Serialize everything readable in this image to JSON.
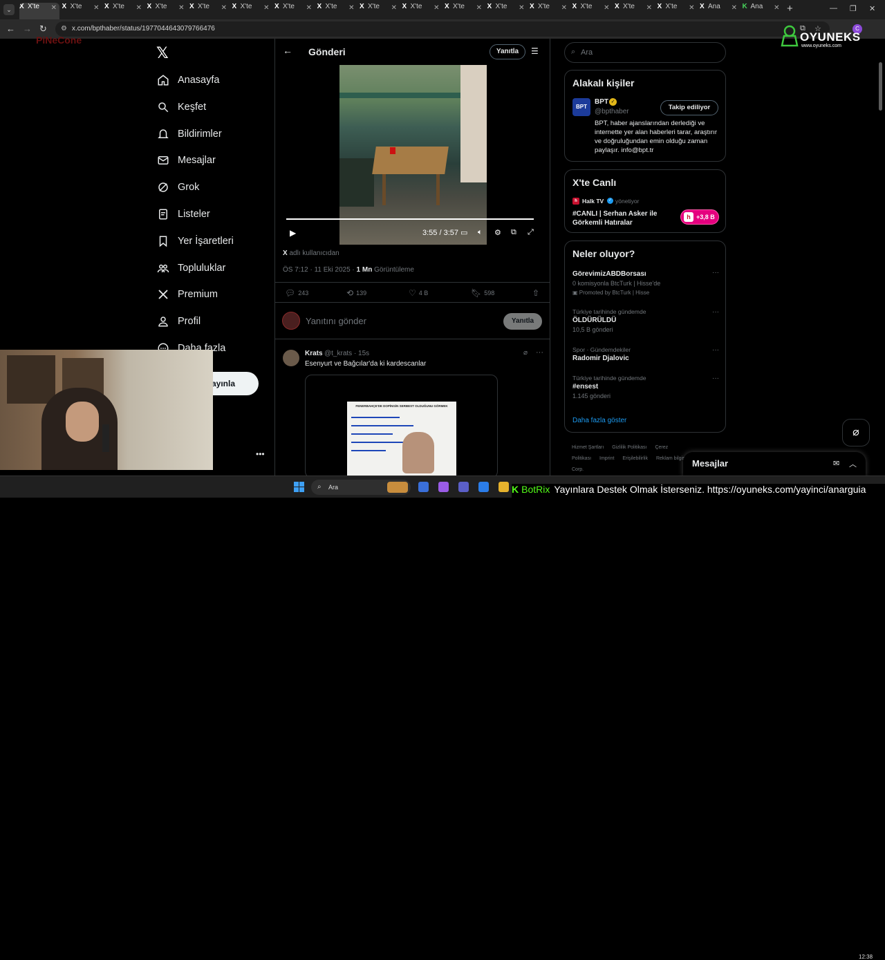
{
  "browser": {
    "tabs": [
      {
        "favicon": "X",
        "label": "X'te"
      },
      {
        "favicon": "X",
        "label": "X'te"
      },
      {
        "favicon": "X",
        "label": "X'te"
      },
      {
        "favicon": "X",
        "label": "X'te"
      },
      {
        "favicon": "X",
        "label": "X'te"
      },
      {
        "favicon": "X",
        "label": "X'te"
      },
      {
        "favicon": "X",
        "label": "X'te"
      },
      {
        "favicon": "X",
        "label": "X'te"
      },
      {
        "favicon": "X",
        "label": "X'te"
      },
      {
        "favicon": "X",
        "label": "X'te"
      },
      {
        "favicon": "X",
        "label": "X'te"
      },
      {
        "favicon": "X",
        "label": "X'te"
      },
      {
        "favicon": "X",
        "label": "X'te"
      },
      {
        "favicon": "X",
        "label": "X'te"
      },
      {
        "favicon": "X",
        "label": "X'te"
      },
      {
        "favicon": "X",
        "label": "X'te"
      },
      {
        "favicon": "X",
        "label": "Ana"
      },
      {
        "favicon": "K",
        "label": "Ana"
      }
    ],
    "active_tab": 0,
    "url": "x.com/bpthaber/status/1977044643079766476",
    "new_tab_glyph": "+"
  },
  "overlay": {
    "brand": "OYUNEKS",
    "brand_site": "www.oyuneks.com",
    "pinecone": "PiNeCone"
  },
  "nav": {
    "items": [
      {
        "label": "Anasayfa",
        "icon": "home-icon"
      },
      {
        "label": "Keşfet",
        "icon": "search-icon"
      },
      {
        "label": "Bildirimler",
        "icon": "bell-icon"
      },
      {
        "label": "Mesajlar",
        "icon": "mail-icon"
      },
      {
        "label": "Grok",
        "icon": "grok-icon"
      },
      {
        "label": "Listeler",
        "icon": "list-icon"
      },
      {
        "label": "Yer İşaretleri",
        "icon": "bookmark-icon"
      },
      {
        "label": "Topluluklar",
        "icon": "communities-icon"
      },
      {
        "label": "Premium",
        "icon": "x-premium-icon"
      },
      {
        "label": "Profil",
        "icon": "profile-icon"
      },
      {
        "label": "Daha fazla",
        "icon": "more-icon"
      }
    ],
    "post_button": "ayınla"
  },
  "main": {
    "title": "Gönderi",
    "reply_pill": "Yanıtla",
    "video": {
      "time": "3:55 / 3:57",
      "progress": 0.99
    },
    "attribution_prefix": "X",
    "attribution": "adlı kullanıcıdan",
    "meta_time": "ÖS 7:12 · 11 Eki 2025 · ",
    "views_value": "1 Mn",
    "views_label": "Görüntüleme",
    "actions": {
      "replies": "243",
      "reposts": "139",
      "likes": "4 B",
      "bookmarks": "598"
    },
    "reply_placeholder": "Yanıtını gönder",
    "reply_button": "Yanıtla",
    "reply_tweet": {
      "name": "Krats",
      "handle": "@t_krats · 15s",
      "text": "Esenyurt ve Bağcılar'da ki kardescanlar",
      "media_headline": "FENERBAHÇE'DE DOPİNGİN SERBEST OLDUĞUNU GÖRMEK"
    }
  },
  "sidebar": {
    "search_placeholder": "Ara",
    "people": {
      "title": "Alakalı kişiler",
      "name": "BPT",
      "avatar_text": "BPT",
      "handle": "@bpthaber",
      "follow": "Takip ediliyor",
      "bio": "BPT, haber ajanslarından derlediği ve internette yer alan haberleri tarar, araştırır ve doğruluğundan emin olduğu zaman paylaşır. info@bpt.tr"
    },
    "live": {
      "title": "X'te Canlı",
      "host": "Halk TV",
      "role": "yönetiyor",
      "stream_title": "#CANLI | Serhan Asker ile Görkemli Hatıralar",
      "count": "+3,8 B"
    },
    "trends": {
      "title": "Neler oluyor?",
      "items": [
        {
          "context": "",
          "name": "GörevimizABDBorsası",
          "sub": "0 komisyonla BtcTurk | Hisse'de",
          "promo": "Promoted by BtcTurk | Hisse"
        },
        {
          "context": "Türkiye tarihinde gündemde",
          "name": "ÖLDÜRÜLDÜ",
          "sub": "10,5 B gönderi",
          "promo": ""
        },
        {
          "context": "Spor · Gündemdekiler",
          "name": "Radomir Djalovic",
          "sub": "",
          "promo": ""
        },
        {
          "context": "Türkiye tarihinde gündemde",
          "name": "#ensest",
          "sub": "1.145 gönderi",
          "promo": ""
        }
      ],
      "show_more": "Daha fazla göster"
    },
    "footer": [
      "Hizmet Şartları",
      "Gizlilik Politikası",
      "Çerez Politikası",
      "Imprint",
      "Erişilebilirlik",
      "Reklam bilgisi",
      "© 2025 X Corp."
    ]
  },
  "messages_drawer": {
    "title": "Mesajlar"
  },
  "taskbar": {
    "search": "Ara",
    "clock": "12:38"
  },
  "ticker": {
    "bot": "BotRix",
    "text": "Yayınlara Destek Olmak İsterseniz. https://oyuneks.com/yayinci/anarguia"
  }
}
